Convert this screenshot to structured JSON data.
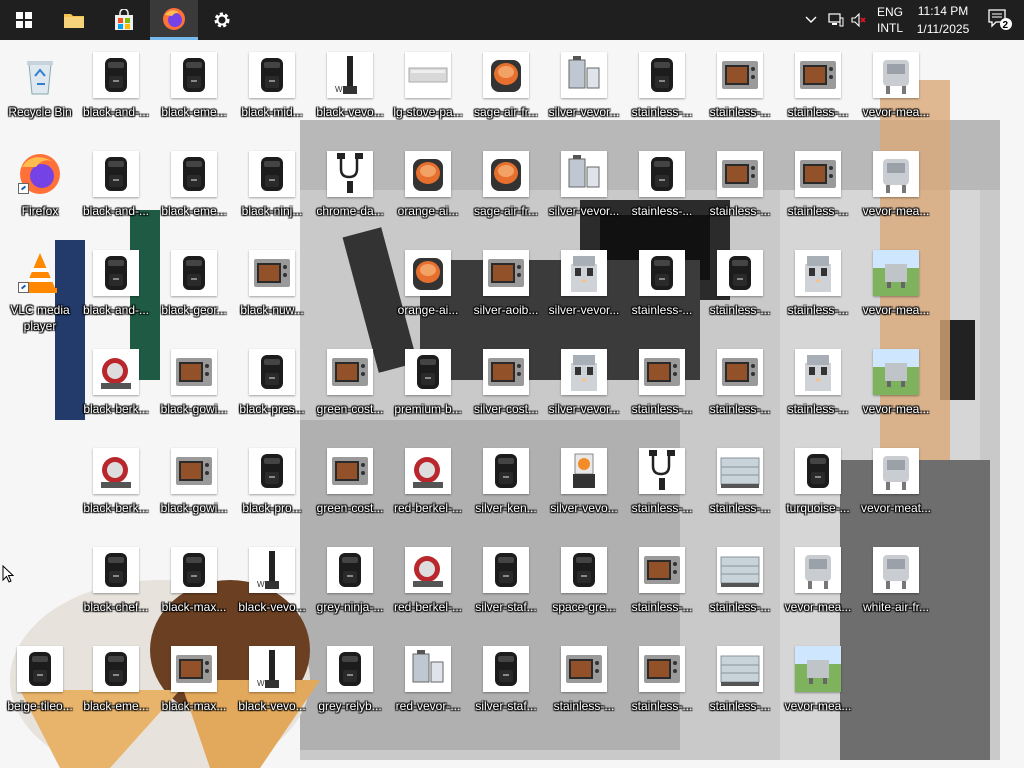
{
  "taskbar": {
    "apps": [
      {
        "name": "start-button",
        "icon": "windows-logo-icon"
      },
      {
        "name": "file-explorer",
        "icon": "folder-icon"
      },
      {
        "name": "microsoft-store",
        "icon": "store-bag-icon"
      },
      {
        "name": "firefox",
        "icon": "firefox-icon",
        "active": true
      },
      {
        "name": "settings",
        "icon": "gear-icon"
      }
    ],
    "tray": {
      "chevron": "show-hidden-icons",
      "network": "network-icon",
      "volume": "volume-muted-icon",
      "lang_line1": "ENG",
      "lang_line2": "INTL",
      "time": "11:14 PM",
      "date": "1/11/2025",
      "notification_count": "2"
    }
  },
  "desktop": {
    "icons": [
      {
        "label": "Recycle Bin",
        "type": "recycle"
      },
      {
        "label": "black-and-...",
        "type": "airfryer"
      },
      {
        "label": "black-eme...",
        "type": "airfryer"
      },
      {
        "label": "black-mid...",
        "type": "airfryer"
      },
      {
        "label": "black-vevo...",
        "type": "blender"
      },
      {
        "label": "lg-stove-pa...",
        "type": "panel"
      },
      {
        "label": "sage-air-fr...",
        "type": "ovenglass"
      },
      {
        "label": "silver-vevor...",
        "type": "distiller"
      },
      {
        "label": "stainless-...",
        "type": "airfryer"
      },
      {
        "label": "stainless-...",
        "type": "oven"
      },
      {
        "label": "stainless-...",
        "type": "oven"
      },
      {
        "label": "vevor-mea...",
        "type": "mixer"
      },
      {
        "label": "Firefox",
        "type": "firefox",
        "shortcut": true
      },
      {
        "label": "black-and-...",
        "type": "airfryer"
      },
      {
        "label": "black-eme...",
        "type": "airfryer"
      },
      {
        "label": "black-ninj...",
        "type": "airfryer"
      },
      {
        "label": "chrome-da...",
        "type": "cable"
      },
      {
        "label": "orange-ai...",
        "type": "ovenglass"
      },
      {
        "label": "sage-air-fr...",
        "type": "ovenglass"
      },
      {
        "label": "silver-vevor...",
        "type": "distiller"
      },
      {
        "label": "stainless-...",
        "type": "airfryer"
      },
      {
        "label": "stainless-...",
        "type": "oven"
      },
      {
        "label": "stainless-...",
        "type": "oven"
      },
      {
        "label": "vevor-mea...",
        "type": "mixer"
      },
      {
        "label": "VLC media player",
        "type": "vlc",
        "shortcut": true
      },
      {
        "label": "black-and-...",
        "type": "airfryer"
      },
      {
        "label": "black-geor...",
        "type": "airfryer"
      },
      {
        "label": "black-nuw...",
        "type": "oven"
      },
      {
        "label": "orange-ai...",
        "type": "ovenglass"
      },
      {
        "label": "silver-aoib...",
        "type": "oven"
      },
      {
        "label": "silver-vevor...",
        "type": "icecream"
      },
      {
        "label": "stainless-...",
        "type": "airfryer"
      },
      {
        "label": "stainless-...",
        "type": "airfryer"
      },
      {
        "label": "stainless-...",
        "type": "icecream"
      },
      {
        "label": "vevor-mea...",
        "type": "grass"
      },
      {
        "label": "black-berk...",
        "type": "slicer"
      },
      {
        "label": "black-gowi...",
        "type": "oven"
      },
      {
        "label": "black-pres...",
        "type": "airfryer"
      },
      {
        "label": "green-cost...",
        "type": "oven"
      },
      {
        "label": "premium-b...",
        "type": "airfryer"
      },
      {
        "label": "silver-cost...",
        "type": "oven"
      },
      {
        "label": "silver-vevor...",
        "type": "icecream"
      },
      {
        "label": "stainless-...",
        "type": "oven"
      },
      {
        "label": "stainless-...",
        "type": "oven"
      },
      {
        "label": "stainless-...",
        "type": "icecream"
      },
      {
        "label": "vevor-mea...",
        "type": "grass"
      },
      {
        "label": "black-berk...",
        "type": "slicer"
      },
      {
        "label": "black-gowi...",
        "type": "oven"
      },
      {
        "label": "black-pro...",
        "type": "airfryer"
      },
      {
        "label": "green-cost...",
        "type": "oven"
      },
      {
        "label": "red-berkel-...",
        "type": "slicer"
      },
      {
        "label": "silver-ken...",
        "type": "airfryer"
      },
      {
        "label": "silver-vevo...",
        "type": "juicer"
      },
      {
        "label": "stainless-...",
        "type": "cable"
      },
      {
        "label": "stainless-...",
        "type": "display"
      },
      {
        "label": "turquoise-...",
        "type": "airfryer"
      },
      {
        "label": "vevor-meat...",
        "type": "mixer"
      },
      {
        "label": "black-chef...",
        "type": "airfryer"
      },
      {
        "label": "black-max...",
        "type": "airfryer"
      },
      {
        "label": "black-vevo...",
        "type": "blender"
      },
      {
        "label": "grey-ninja-...",
        "type": "airfryer"
      },
      {
        "label": "red-berkel-...",
        "type": "slicer"
      },
      {
        "label": "silver-staf...",
        "type": "airfryer"
      },
      {
        "label": "space-gre...",
        "type": "airfryer"
      },
      {
        "label": "stainless-...",
        "type": "oven"
      },
      {
        "label": "stainless-...",
        "type": "display"
      },
      {
        "label": "vevor-mea...",
        "type": "mixer"
      },
      {
        "label": "white-air-fr...",
        "type": "mixer"
      },
      {
        "label": "beige-tileo...",
        "type": "airfryer"
      },
      {
        "label": "black-eme...",
        "type": "airfryer"
      },
      {
        "label": "black-max...",
        "type": "oven"
      },
      {
        "label": "black-vevo...",
        "type": "blender"
      },
      {
        "label": "grey-relyb...",
        "type": "airfryer"
      },
      {
        "label": "red-vevor-...",
        "type": "distiller"
      },
      {
        "label": "silver-staf...",
        "type": "airfryer"
      },
      {
        "label": "stainless-...",
        "type": "oven"
      },
      {
        "label": "stainless-...",
        "type": "oven"
      },
      {
        "label": "stainless-...",
        "type": "display"
      },
      {
        "label": "vevor-mea...",
        "type": "grass"
      }
    ]
  }
}
